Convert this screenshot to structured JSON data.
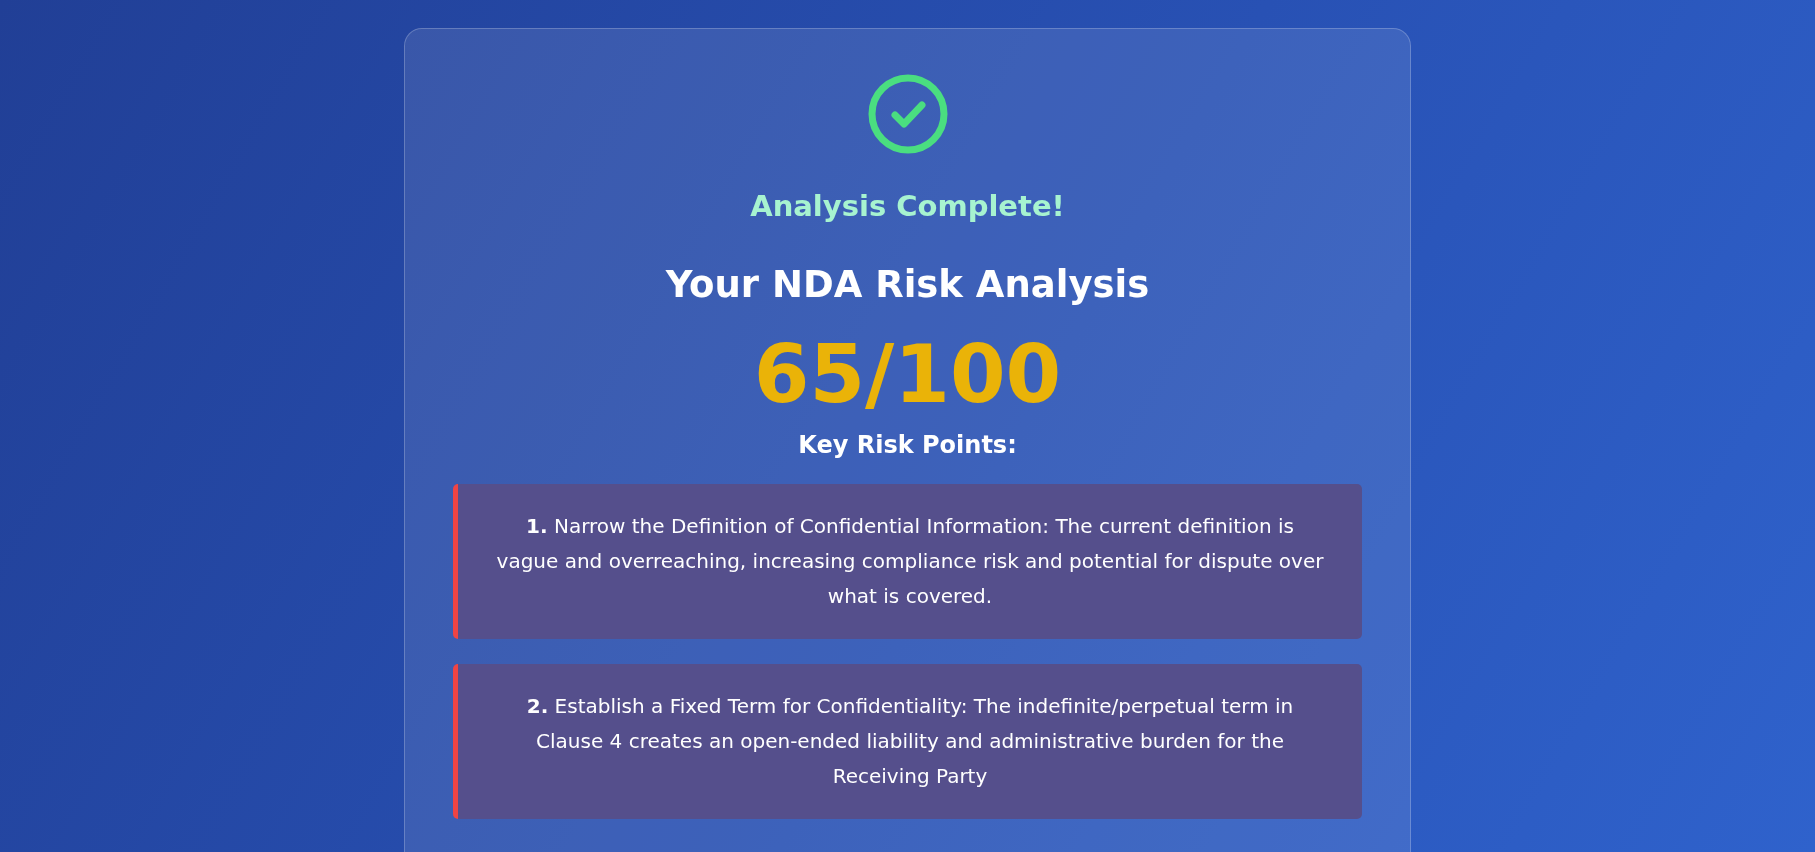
{
  "status": {
    "kind": "success",
    "label": "Analysis Complete!"
  },
  "title": "Your NDA Risk Analysis",
  "score": "65/100",
  "risk_heading": "Key Risk Points:",
  "risks": [
    {
      "number": "1.",
      "text": "Narrow the Definition of Confidential Information: The current definition is vague and overreaching, increasing compliance risk and potential for dispute over what is covered."
    },
    {
      "number": "2.",
      "text": "Establish a Fixed Term for Confidentiality: The indefinite/perpetual term in Clause 4 creates an open-ended liability and administrative burden for the Receiving Party"
    }
  ]
}
